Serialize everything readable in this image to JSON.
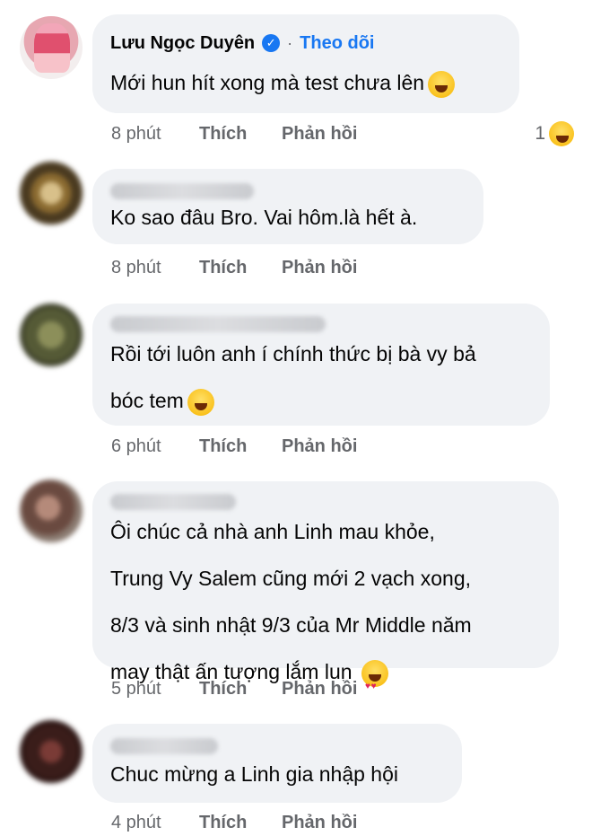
{
  "comments": [
    {
      "author": "Lưu Ngọc Duyên",
      "verified": true,
      "follow_label": "Theo dõi",
      "text": "Mới hun hít xong mà test chưa lên",
      "emoji": "grinning-sweat-emoji",
      "time": "8 phút",
      "like_label": "Thích",
      "reply_label": "Phản hồi",
      "reaction_count": "1",
      "reaction_emoji": "laughing-squint-emoji"
    },
    {
      "author": "",
      "text": "Ko sao đâu Bro. Vai hôm.là hết à.",
      "time": "8 phút",
      "like_label": "Thích",
      "reply_label": "Phản hồi"
    },
    {
      "author": "",
      "text": "Rồi tới luôn anh í chính thức bị bà vy bả\nbóc tem",
      "emoji": "rolling-laughing-emoji",
      "time": "6 phút",
      "like_label": "Thích",
      "reply_label": "Phản hồi"
    },
    {
      "author": "",
      "text": "Ôi chúc cả nhà anh Linh mau khỏe,\nTrung Vy Salem cũng mới 2 vạch xong,\n8/3 và sinh nhật 9/3 của Mr Middle năm\nmay thật ấn tượng lắm lun",
      "emoji": "heart-eyes-emoji",
      "time": "5 phút",
      "like_label": "Thích",
      "reply_label": "Phản hồi"
    },
    {
      "author": "",
      "text": "Chuc mừng a Linh gia nhập hội",
      "time": "4 phút",
      "like_label": "Thích",
      "reply_label": "Phản hồi"
    }
  ]
}
